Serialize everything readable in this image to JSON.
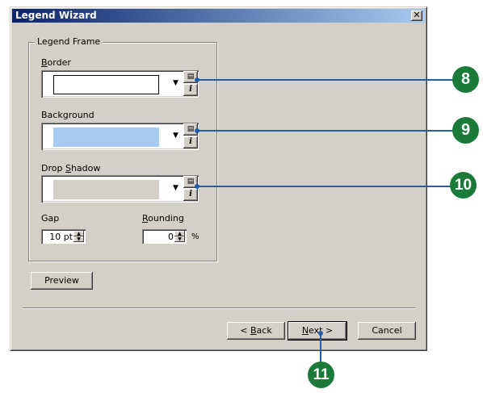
{
  "window": {
    "title": "Legend Wizard",
    "close_glyph": "✕"
  },
  "legend_frame": {
    "label": "Legend Frame",
    "border": {
      "label_first": "B",
      "label_rest": "order"
    },
    "background": {
      "label": "Background"
    },
    "drop_shadow": {
      "label_pre": "Drop ",
      "label_u": "S",
      "label_post": "hadow"
    },
    "gap": {
      "label": "Gap",
      "value": "10 pt"
    },
    "rounding": {
      "label_u": "R",
      "label_rest": "ounding",
      "value": "0",
      "unit": "%"
    }
  },
  "preview_label": "Preview",
  "buttons": {
    "back_pre": "< ",
    "back_u": "B",
    "back_post": "ack",
    "next_u": "N",
    "next_post": "ext >",
    "cancel": "Cancel"
  },
  "callouts": [
    "8",
    "9",
    "10",
    "11"
  ],
  "colors": {
    "background_swatch": "#a6caf0",
    "callout": "#1a7a3a",
    "leader_line": "#1f5fa8"
  }
}
